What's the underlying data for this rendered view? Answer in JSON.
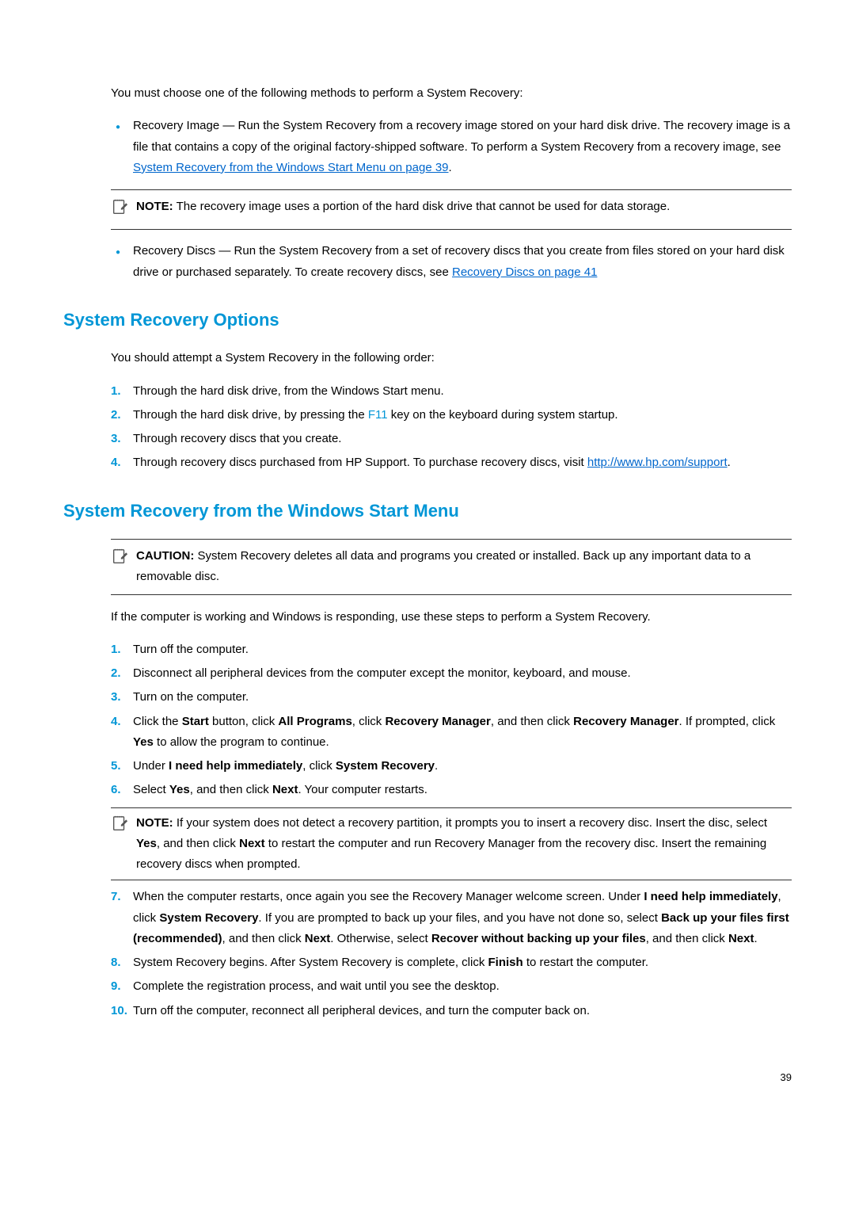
{
  "intro": "You must choose one of the following methods to perform a System Recovery:",
  "methods": {
    "image_before": "Recovery Image — Run the System Recovery from a recovery image stored on your hard disk drive. The recovery image is a file that contains a copy of the original factory-shipped software. To perform a System Recovery from a recovery image, see",
    "image_link": " System Recovery from the Windows Start Menu on page 39",
    "image_after": ".",
    "discs_before": "Recovery Discs — Run the System Recovery from a set of recovery discs that you create from files stored on your hard disk drive or purchased separately. To create recovery discs, see",
    "discs_link": "Recovery Discs on page 41"
  },
  "note1_label": "NOTE:",
  "note1_text": " The recovery image uses a portion of the hard disk drive that cannot be used for data storage.",
  "h2_options": "System Recovery Options",
  "options_intro": "You should attempt a System Recovery in the following order:",
  "options": [
    "Through the hard disk drive, from the Windows Start menu.",
    "Through recovery discs that you create."
  ],
  "opt2_before": "Through the hard disk drive, by pressing the ",
  "opt2_key": "F11",
  "opt2_after": " key on the keyboard during system startup.",
  "opt4_before": "Through recovery discs purchased from HP Support. To purchase recovery discs, visit ",
  "opt4_link": "http://www.hp.com/support",
  "opt4_after": ".",
  "h2_winstart": "System Recovery from the Windows Start Menu",
  "caution_label": "CAUTION:",
  "caution_text": " System Recovery deletes all data and programs you created or installed. Back up any important data to a removable disc.",
  "winstart_intro": "If the computer is working and Windows is responding, use these steps to perform a System Recovery.",
  "steps": {
    "s1": "Turn off the computer.",
    "s2": "Disconnect all peripheral devices from the computer except the monitor, keyboard, and mouse.",
    "s3": "Turn on the computer.",
    "s4_a": "Click the ",
    "s4_start": "Start",
    "s4_b": " button, click ",
    "s4_ap": "All Programs",
    "s4_c": ", click ",
    "s4_rm": "Recovery Manager",
    "s4_d": ", and then click ",
    "s4_rm2": "Recovery Manager",
    "s4_e": ". If prompted, click ",
    "s4_yes": "Yes",
    "s4_f": " to allow the program to continue.",
    "s5_a": "Under ",
    "s5_b": "I need help immediately",
    "s5_c": ", click ",
    "s5_d": "System Recovery",
    "s5_e": ".",
    "s6_a": "Select ",
    "s6_yes": "Yes",
    "s6_b": ", and then click ",
    "s6_next": "Next",
    "s6_c": ". Your computer restarts.",
    "note2_label": "NOTE:",
    "note2_a": " If your system does not detect a recovery partition, it prompts you to insert a recovery disc. Insert the disc, select ",
    "note2_yes": "Yes",
    "note2_b": ", and then click ",
    "note2_next": "Next",
    "note2_c": " to restart the computer and run Recovery Manager from the recovery disc. Insert the remaining recovery discs when prompted.",
    "s7_a": "When the computer restarts, once again you see the Recovery Manager welcome screen. Under ",
    "s7_b": "I need help immediately",
    "s7_c": ", click ",
    "s7_d": "System Recovery",
    "s7_e": ". If you are prompted to back up your files, and you have not done so, select ",
    "s7_f": "Back up your files first (recommended)",
    "s7_g": ", and then click ",
    "s7_h": "Next",
    "s7_i": ". Otherwise, select ",
    "s7_j": "Recover without backing up your files",
    "s7_k": ", and then click ",
    "s7_l": "Next",
    "s7_m": ".",
    "s8_a": "System Recovery begins. After System Recovery is complete, click ",
    "s8_b": "Finish",
    "s8_c": " to restart the computer.",
    "s9": "Complete the registration process, and wait until you see the desktop.",
    "s10": "Turn off the computer, reconnect all peripheral devices, and turn the computer back on."
  },
  "page": "39"
}
